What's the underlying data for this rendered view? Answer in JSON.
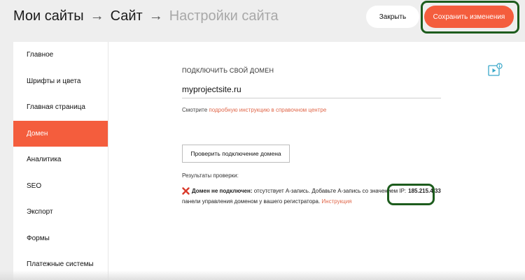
{
  "breadcrumb": {
    "items": [
      "Мои сайты",
      "Сайт",
      "Настройки сайта"
    ],
    "separator": "→"
  },
  "header": {
    "close_label": "Закрыть",
    "save_label": "Сохранить изменения"
  },
  "sidebar": {
    "items": [
      {
        "label": "Главное",
        "active": false
      },
      {
        "label": "Шрифты и цвета",
        "active": false
      },
      {
        "label": "Главная страница",
        "active": false
      },
      {
        "label": "Домен",
        "active": true
      },
      {
        "label": "Аналитика",
        "active": false
      },
      {
        "label": "SEO",
        "active": false
      },
      {
        "label": "Экспорт",
        "active": false
      },
      {
        "label": "Формы",
        "active": false
      },
      {
        "label": "Платежные системы",
        "active": false
      }
    ]
  },
  "domain": {
    "section_label": "ПОДКЛЮЧИТЬ СВОЙ ДОМЕН",
    "input_value": "myprojectsite.ru",
    "hint_prefix": "Смотрите",
    "hint_link": "подробную инструкцию в справочном центре",
    "check_button": "Проверить подключение домена",
    "results_label": "Результаты проверки:",
    "result": {
      "status_bold": "Домен не подключен:",
      "message": "отсутствует А-запись. Добавьте А-запись со значением IP:",
      "ip": "185.215.4.33",
      "message_line2": "панели управления доменом у вашего регистратора.",
      "link": "Инструкция"
    }
  },
  "icons": {
    "video_help": "video-help-icon",
    "error": "x-mark-icon"
  },
  "colors": {
    "accent": "#f45d3d",
    "link": "#e0674a",
    "highlight": "#1d5c1d",
    "error": "#d93a2b",
    "icon": "#3aa8c9"
  }
}
